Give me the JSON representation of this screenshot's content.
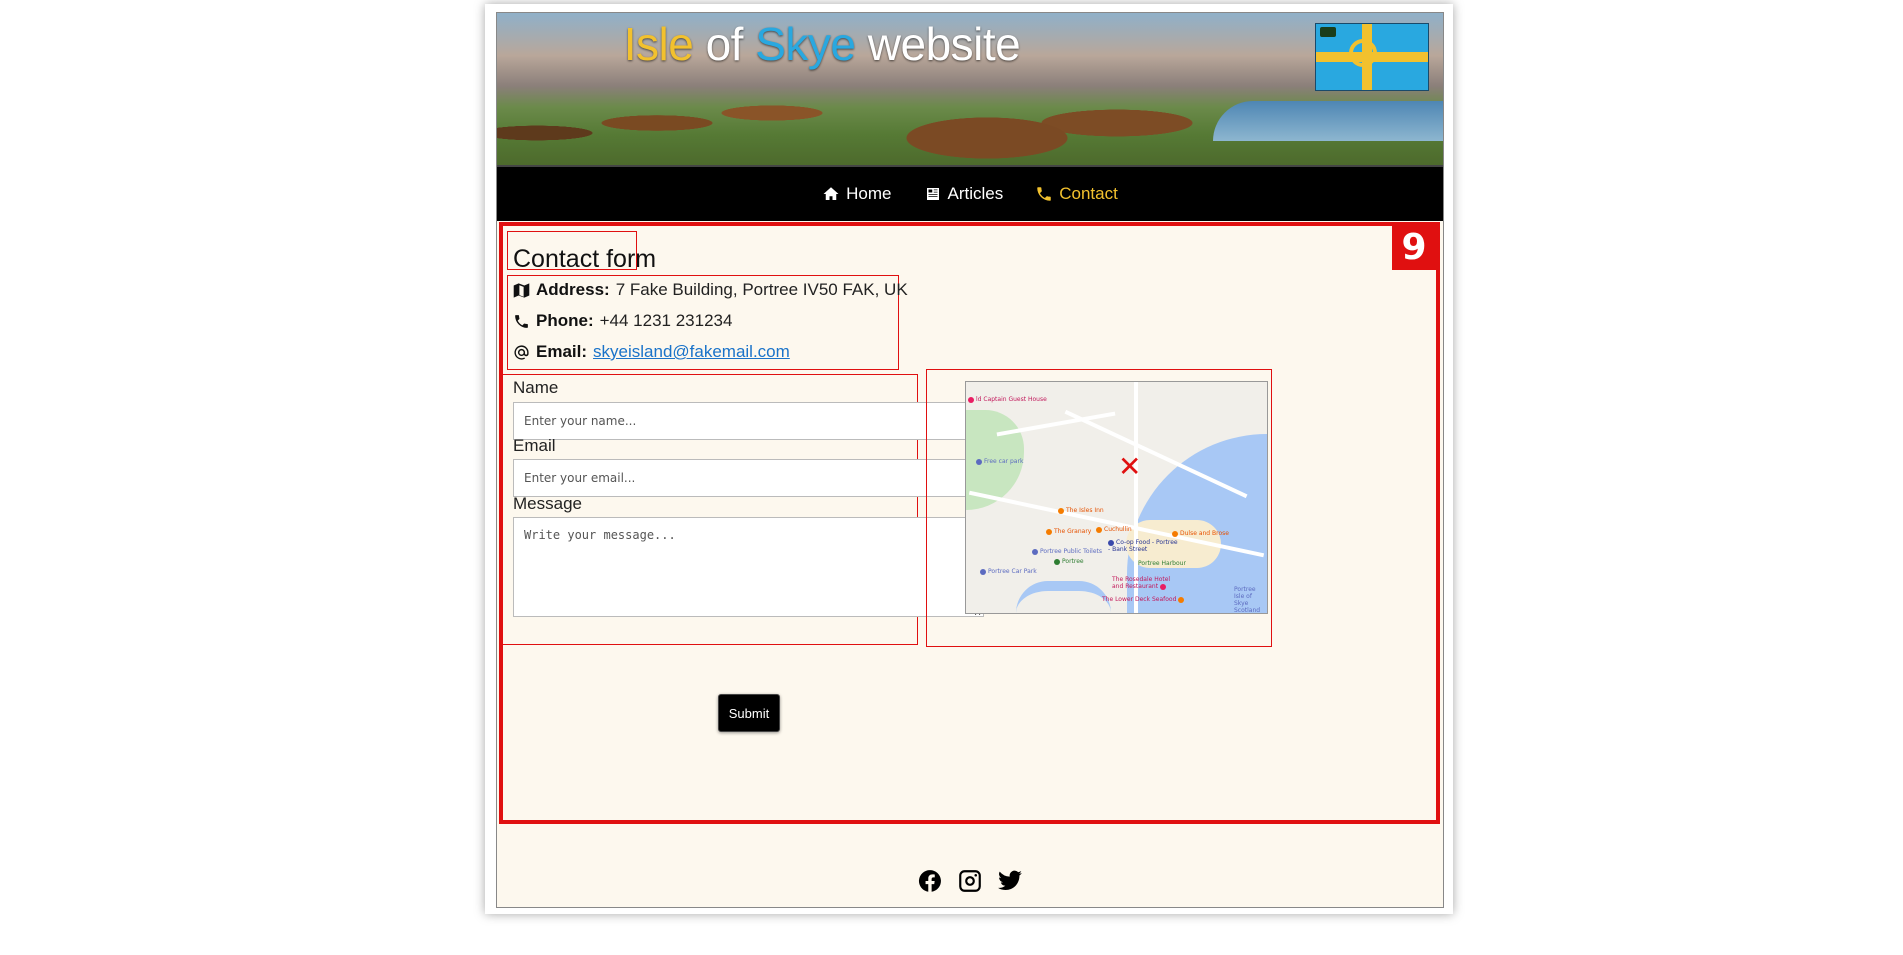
{
  "banner": {
    "title_part1": "Isle",
    "title_part2": " of ",
    "title_part3": "Skye",
    "title_part4": " website"
  },
  "nav": {
    "items": [
      {
        "label": "Home",
        "icon": "home-icon"
      },
      {
        "label": "Articles",
        "icon": "newspaper-icon"
      },
      {
        "label": "Contact",
        "icon": "phone-icon",
        "active": true
      }
    ]
  },
  "section": {
    "badge": "9",
    "heading": "Contact form",
    "address_label": "Address:",
    "address_value": "7 Fake Building, Portree IV50 FAK, UK",
    "phone_label": "Phone:",
    "phone_value": "+44 1231 231234",
    "email_label": "Email:",
    "email_value": "skyeisland@fakemail.com"
  },
  "form": {
    "name_label": "Name",
    "name_placeholder": "Enter your name...",
    "email_label": "Email",
    "email_placeholder": "Enter your email...",
    "message_label": "Message",
    "message_placeholder": "Write your message...",
    "submit_label": "Submit"
  },
  "map": {
    "labels": [
      "ld Captain Guest House",
      "Free car park",
      "The Isles Inn",
      "The Granary",
      "Cuchullin",
      "Co-op Food - Portree - Bank Street",
      "Dulse and Brose",
      "Portree Public Toilets",
      "Portree",
      "Portree Harbour",
      "Portree Car Park",
      "The Rosedale Hotel and Restaurant",
      "The Lower Deck Seafood",
      "Portree Isle of Skye Scotland"
    ]
  },
  "colors": {
    "accent_yellow": "#f2c12e",
    "accent_blue": "#29a8e0",
    "highlight_red": "#e01010",
    "nav_bg": "#000000",
    "content_bg": "#fdf8ee"
  },
  "footer": {
    "socials": [
      "facebook-icon",
      "instagram-icon",
      "twitter-icon"
    ]
  }
}
